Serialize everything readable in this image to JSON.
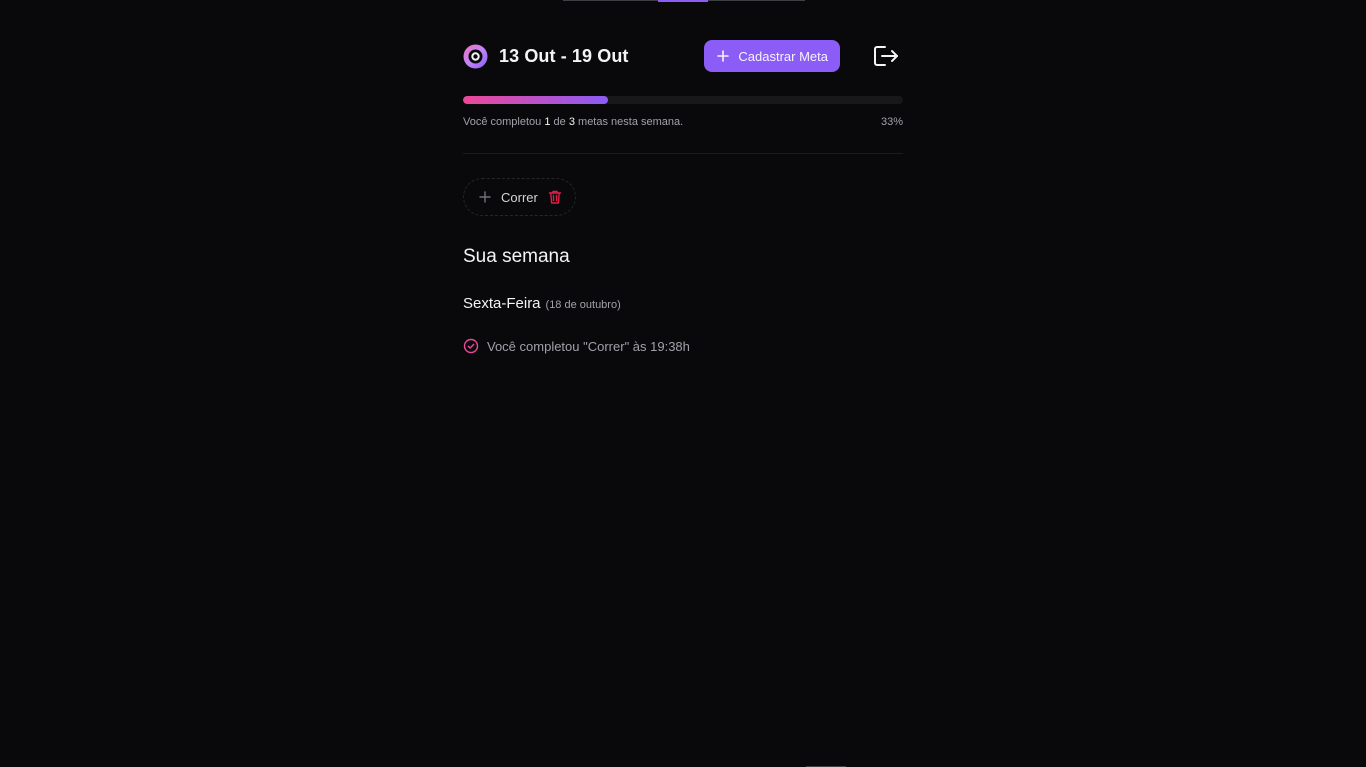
{
  "header": {
    "week_range": "13 Out - 19 Out",
    "add_goal_label": "Cadastrar Meta",
    "logo_icon": "in-orbit-logo-icon",
    "logout_icon": "logout-icon"
  },
  "progress": {
    "percent_value": 0.33,
    "text_prefix": "Você completou",
    "completed": "1",
    "text_middle": "de",
    "total": "3",
    "text_suffix": "metas nesta semana.",
    "percent_label": "33%",
    "gradient_start": "#ec4899",
    "gradient_end": "#8b5cf6"
  },
  "pending_goals": [
    {
      "title": "Correr",
      "icon": "plus-icon",
      "delete_icon": "trash-icon"
    }
  ],
  "summary": {
    "title": "Sua semana",
    "days": [
      {
        "weekday": "Sexta-Feira",
        "date": "(18 de outubro)",
        "completions": [
          {
            "text": "Você completou \"Correr\" às 19:38h",
            "icon": "check-circle-icon"
          }
        ]
      }
    ]
  },
  "colors": {
    "accent": "#8b5cf6",
    "pink": "#ec4899",
    "danger": "#e11d48",
    "background": "#09090b"
  }
}
